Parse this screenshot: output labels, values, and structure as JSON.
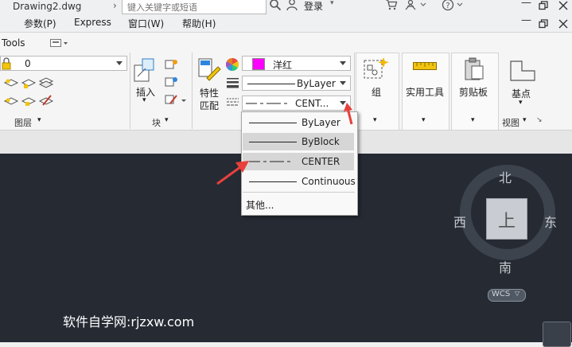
{
  "titlebar": {
    "doc_title": "Drawing2.dwg",
    "search_placeholder": "键入关键字或短语",
    "login_label": "登录"
  },
  "menubar": {
    "items": [
      "参数(P)",
      "Express",
      "窗口(W)",
      "帮助(H)"
    ]
  },
  "ribbon": {
    "tools_label": "Tools",
    "layer": {
      "current_value": "0",
      "panel_label": "图层"
    },
    "block": {
      "insert_label": "插入",
      "panel_label": "块"
    },
    "properties": {
      "match_label_1": "特性",
      "match_label_2": "匹配",
      "color_value": "洋红",
      "color_swatch": "#ff00ff",
      "lineweight_value": "ByLayer",
      "linetype_value": "CENT..."
    },
    "group_label": "组",
    "utilities_label": "实用工具",
    "clipboard_label": "剪贴板",
    "base_label": "基点",
    "view_panel_label": "视图"
  },
  "linetype_dropdown": {
    "items": [
      {
        "label": "ByLayer",
        "selected": false
      },
      {
        "label": "ByBlock",
        "selected": true
      },
      {
        "label": "CENTER",
        "selected": true
      },
      {
        "label": "Continuous",
        "selected": false
      }
    ],
    "other_label": "其他..."
  },
  "viewcube": {
    "north": "北",
    "south": "南",
    "east": "东",
    "west": "西",
    "face": "上",
    "wcs_label": "WCS"
  },
  "watermark": "软件自学网:rjzxw.com",
  "colors": {
    "canvas_bg": "#252a33",
    "accent_red": "#e8403c"
  }
}
